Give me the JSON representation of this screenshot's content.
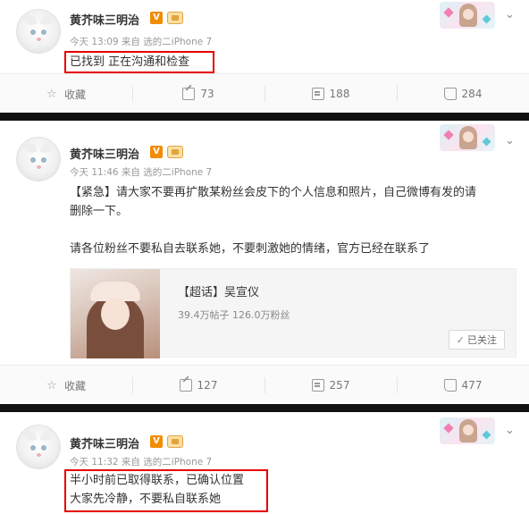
{
  "posts": [
    {
      "author": "黄芥味三明治",
      "v_badge": "V",
      "meta": "今天 13:09 来自 选的二iPhone 7",
      "lines": [
        "已找到 正在沟通和检查"
      ],
      "actions": {
        "favorite": "收藏",
        "share": "73",
        "comment": "188",
        "like": "284"
      }
    },
    {
      "author": "黄芥味三明治",
      "v_badge": "V",
      "meta": "今天 11:46 来自 选的二iPhone 7",
      "lines": [
        "【紧急】请大家不要再扩散某粉丝会皮下的个人信息和照片，自己微博有发的请",
        "删除一下。",
        "请各位粉丝不要私自去联系她，不要刺激她的情绪，官方已经在联系了"
      ],
      "card": {
        "title": "【超话】吴宣仪",
        "stats": "39.4万帖子 126.0万粉丝",
        "follow_label": "已关注"
      },
      "actions": {
        "favorite": "收藏",
        "share": "127",
        "comment": "257",
        "like": "477"
      }
    },
    {
      "author": "黄芥味三明治",
      "v_badge": "V",
      "meta": "今天 11:32 来自 选的二iPhone 7",
      "lines": [
        "半小时前已取得联系，已确认位置",
        "大家先冷静，不要私自联系她"
      ]
    }
  ],
  "colors": {
    "highlight": "#e60000",
    "badge": "#f28c00"
  },
  "icons": {
    "favorite": "star-icon",
    "share": "share-icon",
    "comment": "comment-icon",
    "like": "thumbs-up-icon",
    "more": "chevron-down-icon"
  }
}
